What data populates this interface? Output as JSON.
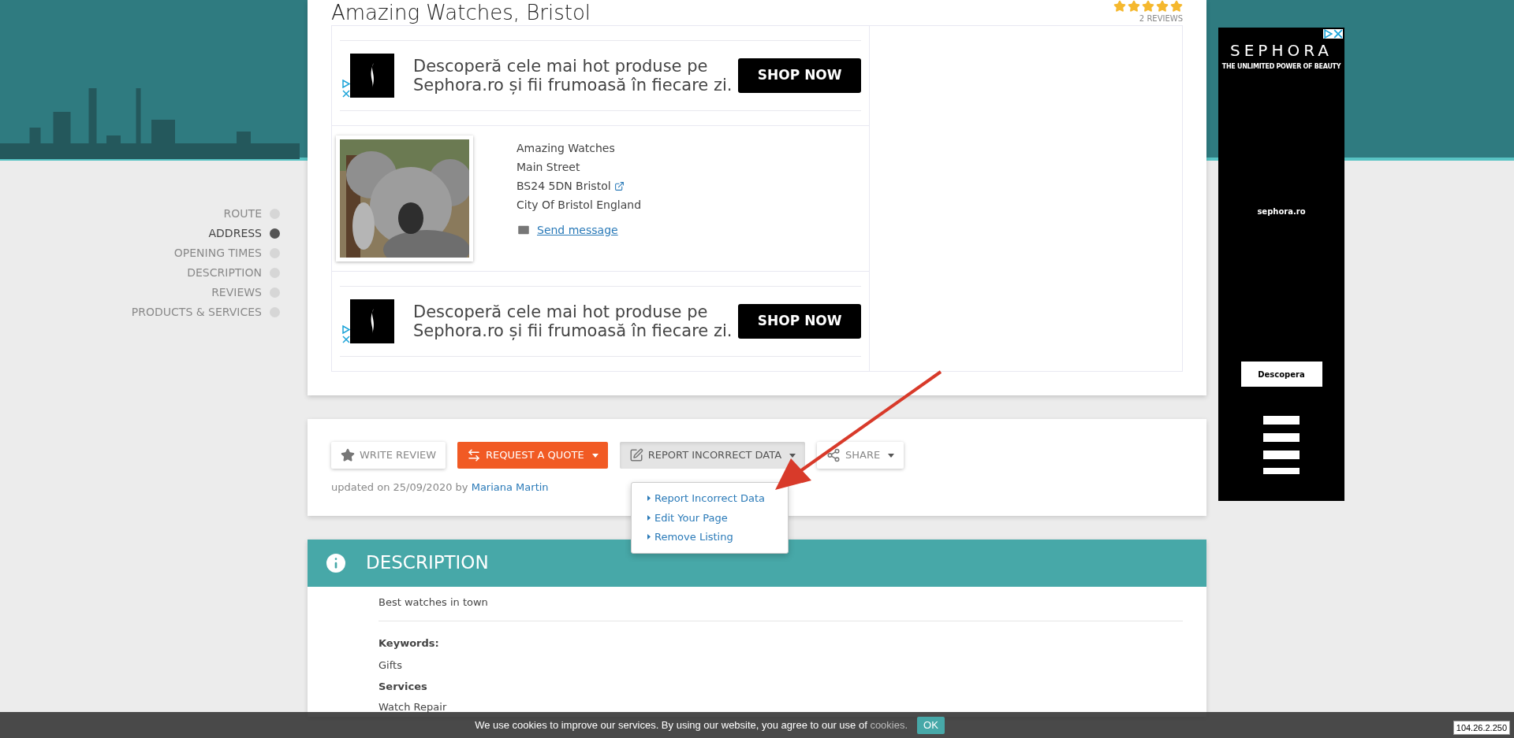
{
  "listing": {
    "title": "Amazing Watches, Bristol",
    "stars": 5,
    "reviews": "2 REVIEWS"
  },
  "ads": [
    {
      "headline": "Descoperă cele mai hot produse pe Sephora.ro și fii frumoasă în fiecare zi.",
      "button": "SHOP NOW"
    },
    {
      "headline": "Descoperă cele mai hot produse pe Sephora.ro și fii frumoasă în fiecare zi.",
      "button": "SHOP NOW"
    }
  ],
  "address": {
    "lines": [
      "Amazing Watches",
      "Main Street",
      "BS24 5DN Bristol",
      "City Of Bristol England"
    ],
    "send_message": "Send message"
  },
  "side_nav": [
    {
      "label": "ROUTE",
      "selected": false
    },
    {
      "label": "ADDRESS",
      "selected": true
    },
    {
      "label": "OPENING TIMES",
      "selected": false
    },
    {
      "label": "DESCRIPTION",
      "selected": false
    },
    {
      "label": "REVIEWS",
      "selected": false
    },
    {
      "label": "PRODUCTS & SERVICES",
      "selected": false
    }
  ],
  "actions": [
    {
      "kind": "plain",
      "label": "WRITE REVIEW",
      "dropdown": false,
      "expanded": false
    },
    {
      "kind": "primary",
      "label": "REQUEST A QUOTE",
      "dropdown": true,
      "expanded": false
    },
    {
      "kind": "plain",
      "label": "REPORT INCORRECT DATA",
      "dropdown": true,
      "expanded": true
    },
    {
      "kind": "plain",
      "label": "SHARE",
      "dropdown": true,
      "expanded": false
    }
  ],
  "updated": {
    "text": "updated on 25/09/2020 by",
    "author": "Mariana Martin"
  },
  "dropdown_menu": [
    "Report Incorrect Data",
    "Edit Your Page",
    "Remove Listing"
  ],
  "description": {
    "heading": "DESCRIPTION",
    "text": "Best watches in town",
    "keywords_label": "Keywords:",
    "keywords": "Gifts",
    "services_label": "Services",
    "services": "Watch Repair"
  },
  "side_ad": {
    "brand": "SEPHORA",
    "tagline": "THE UNLIMITED POWER OF BEAUTY",
    "domain": "sephora.ro",
    "button": "Descopera"
  },
  "cookie_bar": {
    "text": "We use cookies to improve our services. By using our website, you agree to our use of",
    "link": "cookies.",
    "button": "OK"
  },
  "ip_badge": "104.26.2.250"
}
